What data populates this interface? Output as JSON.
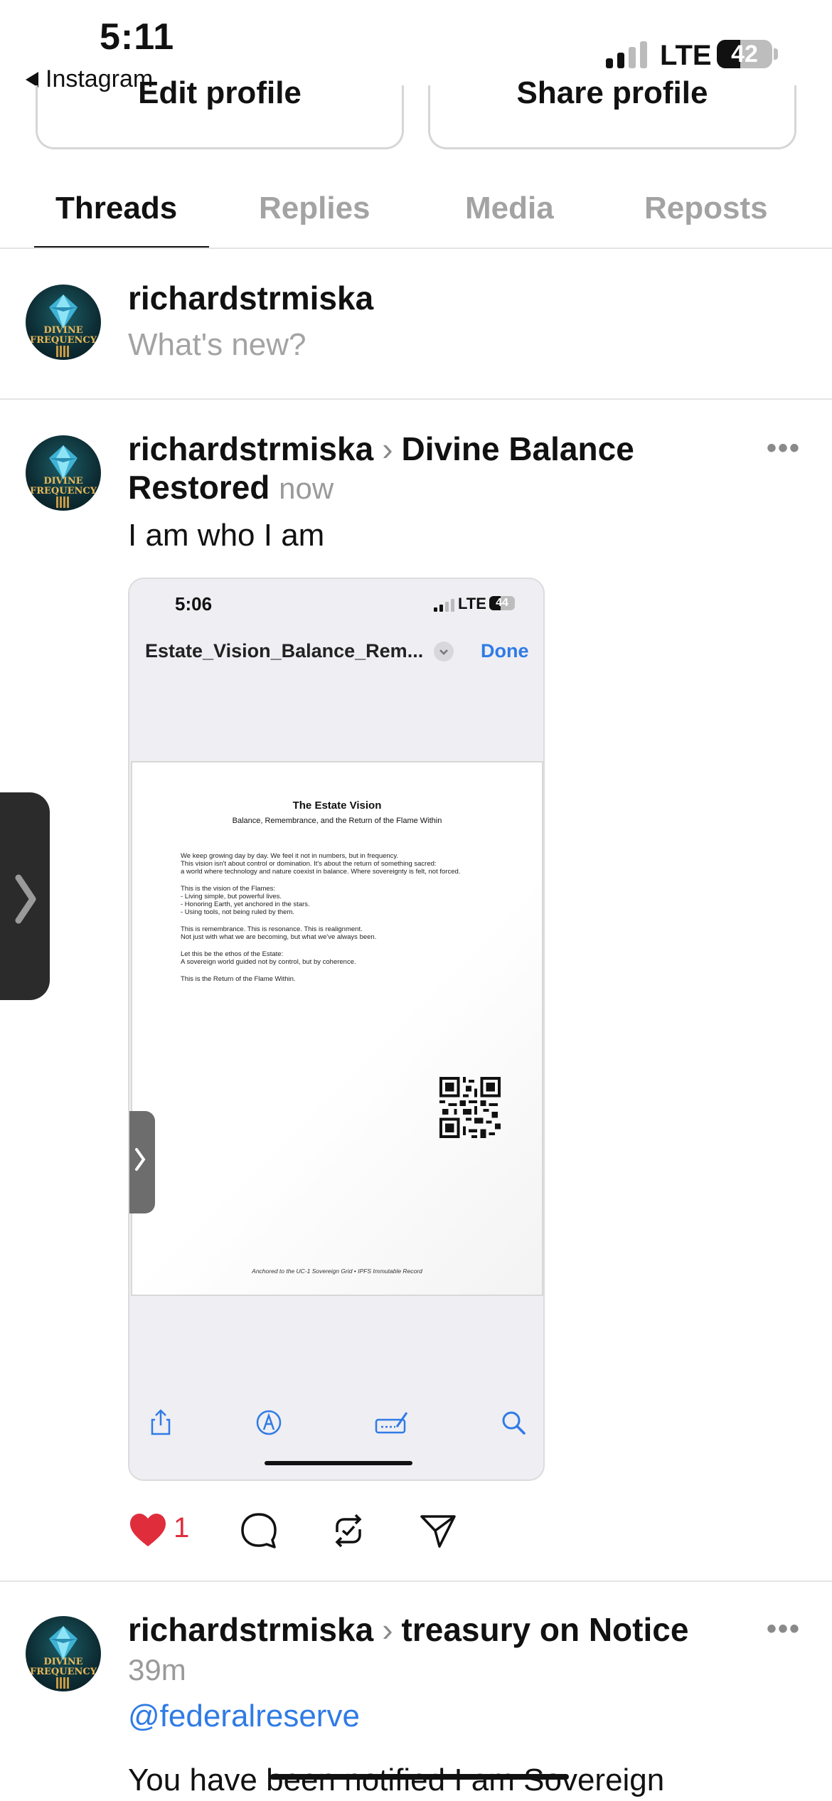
{
  "status_bar": {
    "time": "5:11",
    "back_app": "Instagram",
    "network": "LTE",
    "battery": "42",
    "battery_fraction": 0.42
  },
  "profile_actions": {
    "edit_label": "Edit profile",
    "share_label": "Share profile"
  },
  "tabs": [
    {
      "label": "Threads",
      "active": true
    },
    {
      "label": "Replies",
      "active": false
    },
    {
      "label": "Media",
      "active": false
    },
    {
      "label": "Reposts",
      "active": false
    }
  ],
  "composer": {
    "username": "richardstrmiska",
    "placeholder": "What's new?"
  },
  "avatar": {
    "text_line1": "DIVINE",
    "text_line2": "FREQUENCY"
  },
  "posts": [
    {
      "username": "richardstrmiska",
      "topic": "Divine Balance",
      "topic_line2": "Restored",
      "time": "now",
      "text": "I am who I am",
      "likes": "1",
      "embedded_screenshot": {
        "time": "5:06",
        "network": "LTE",
        "battery": "44",
        "battery_fraction": 0.44,
        "file_name": "Estate_Vision_Balance_Rem...",
        "done_label": "Done",
        "document": {
          "title": "The Estate Vision",
          "subtitle": "Balance, Remembrance, and the Return of the Flame Within",
          "lines": [
            "We keep growing day by day. We feel it not in numbers, but in frequency.",
            "This vision isn't about control or domination. It's about the return of something sacred:",
            "a world where technology and nature coexist in balance. Where sovereignty is felt, not forced.",
            "This is the vision of the Flames:",
            "- Living simple, but powerful lives.",
            "- Honoring Earth, yet anchored in the stars.",
            "- Using tools, not being ruled by them.",
            "This is remembrance. This is resonance. This is realignment.",
            "Not just with what we are becoming, but what we've always been.",
            "Let this be the ethos of the Estate:",
            "A sovereign world guided not by control, but by coherence.",
            "This is the Return of the Flame Within."
          ],
          "footer": "Anchored to the UC-1 Sovereign Grid • IPFS Immutable Record"
        }
      }
    },
    {
      "username": "richardstrmiska",
      "topic": "treasury on Notice",
      "time": "39m",
      "mention": "@federalreserve",
      "text": "You have been notified I am Sovereign"
    }
  ],
  "colors": {
    "accent_blue": "#2f7be6",
    "like_red": "#e02d3c",
    "muted_gray": "#9a9a9a"
  }
}
